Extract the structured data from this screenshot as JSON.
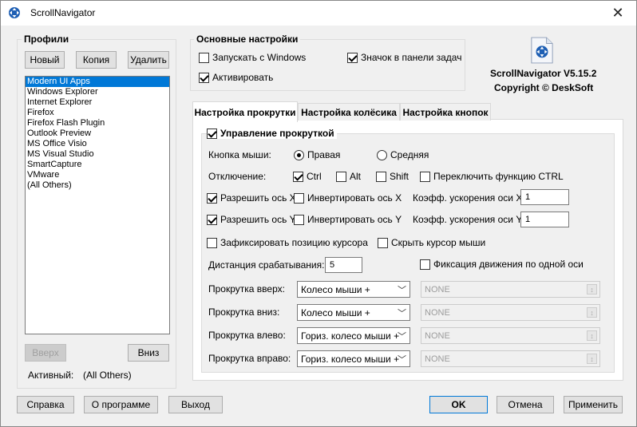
{
  "window": {
    "title": "ScrollNavigator",
    "close_glyph": "✕"
  },
  "profiles": {
    "title": "Профили",
    "buttons": {
      "new": "Новый",
      "copy": "Копия",
      "delete": "Удалить"
    },
    "items": [
      "Modern UI Apps",
      "Windows Explorer",
      "Internet Explorer",
      "Firefox",
      "Firefox Flash Plugin",
      "Outlook Preview",
      "MS Office Visio",
      "MS Visual Studio",
      "SmartCapture",
      "VMware",
      "(All Others)"
    ],
    "selected_index": 0,
    "up_button": "Вверх",
    "down_button": "Вниз",
    "active_label": "Активный:",
    "active_value": "(All Others)"
  },
  "main_settings": {
    "title": "Основные настройки",
    "run_windows": {
      "label": "Запускать с Windows",
      "checked": false
    },
    "tray_icon": {
      "label": "Значок в панели задач",
      "checked": true
    },
    "activate": {
      "label": "Активировать",
      "checked": true
    }
  },
  "about": {
    "product": "ScrollNavigator V5.15.2",
    "copyright": "Copyright © DeskSoft"
  },
  "tabs": [
    {
      "label": "Настройка прокрутки",
      "active": true
    },
    {
      "label": "Настройка колёсика",
      "active": false
    },
    {
      "label": "Настройка кнопок",
      "active": false
    }
  ],
  "scroll_settings": {
    "group_label": "Управление прокруткой",
    "group_checked": true,
    "mouse_button_label": "Кнопка мыши:",
    "radio_right": "Правая",
    "radio_middle": "Средняя",
    "right_selected": true,
    "disable_label": "Отключение:",
    "ctrl": {
      "label": "Ctrl",
      "checked": true
    },
    "alt": {
      "label": "Alt",
      "checked": false
    },
    "shift": {
      "label": "Shift",
      "checked": false
    },
    "toggle_ctrl": {
      "label": "Переключить функцию CTRL",
      "checked": false
    },
    "allow_x": {
      "label": "Разрешить ось X",
      "checked": true
    },
    "invert_x": {
      "label": "Инвертировать ось X",
      "checked": false
    },
    "accel_x_label": "Коэфф. ускорения оси X",
    "accel_x_value": "1",
    "allow_y": {
      "label": "Разрешить ось Y",
      "checked": true
    },
    "invert_y": {
      "label": "Инвертировать ось Y",
      "checked": false
    },
    "accel_y_label": "Коэфф. ускорения оси Y",
    "accel_y_value": "1",
    "fix_cursor": {
      "label": "Зафиксировать позицию курсора",
      "checked": false
    },
    "hide_cursor": {
      "label": "Скрыть курсор мыши",
      "checked": false
    },
    "distance_label": "Дистанция срабатывания:",
    "distance_value": "5",
    "single_axis": {
      "label": "Фиксация движения по одной оси",
      "checked": false
    },
    "scroll_rows": [
      {
        "label": "Прокрутка вверх:",
        "action": "Колесо мыши +",
        "modifier": "NONE"
      },
      {
        "label": "Прокрутка вниз:",
        "action": "Колесо мыши +",
        "modifier": "NONE"
      },
      {
        "label": "Прокрутка влево:",
        "action": "Гориз. колесо мыши +",
        "modifier": "NONE"
      },
      {
        "label": "Прокрутка вправо:",
        "action": "Гориз. колесо мыши +",
        "modifier": "NONE"
      }
    ]
  },
  "footer": {
    "help": "Справка",
    "about": "О программе",
    "exit": "Выход",
    "ok": "OK",
    "cancel": "Отмена",
    "apply": "Применить"
  },
  "icons": {
    "app": "scroll-arrows-icon",
    "logo": "document-scroll-icon",
    "dropdown": "chevron-down-icon",
    "spin": "spin-arrows-icon"
  },
  "colors": {
    "selection": "#0078d7",
    "logo_blue": "#1e5fb4"
  }
}
